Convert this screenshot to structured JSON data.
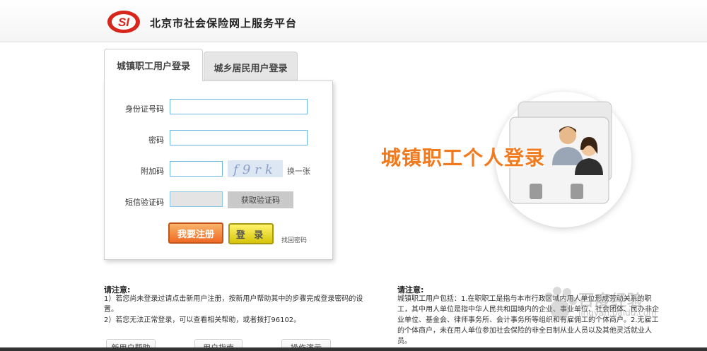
{
  "header": {
    "site_title": "北京市社会保险网上服务平台",
    "logo_text": "SI"
  },
  "tabs": [
    {
      "label": "城镇职工用户登录",
      "active": true
    },
    {
      "label": "城乡居民用户登录",
      "active": false
    }
  ],
  "form": {
    "id_label": "身份证号码",
    "id_value": "",
    "password_label": "密码",
    "password_value": "",
    "captcha_label": "附加码",
    "captcha_value": "",
    "captcha_image_text": "f9rk",
    "refresh_label": "换一张",
    "sms_label": "短信验证码",
    "sms_value": "",
    "sms_button_label": "获取验证码",
    "register_label": "我要注册",
    "login_label": "登 录",
    "forgot_label": "找回密码"
  },
  "promo": {
    "text": "城镇职工个人登录"
  },
  "notice_left": {
    "title": "请注意:",
    "lines": [
      "1）若您尚未登录过请点击新用户注册，按新用户帮助其中的步骤完成登录密码的设",
      "置。",
      "2）若您无法正常登录，可以查看相关帮助，或者拨打96102。"
    ]
  },
  "notice_right": {
    "title": "请注意:",
    "lines": [
      "城镇职工用户包括：1.在职职工是指与本市行政区域内用人单位形成劳动关系的职",
      "工，其中用人单位是指中华人民共和国境内的企业、事业单位、社会团体、民办非企",
      "业单位、基金会、律师事务所、会计事务所等组织和有雇佣工的个体商户。2.无雇工",
      "的个体商户，未在用人单位参加社会保险的非全日制从业人员以及其他灵活就业人",
      "员。"
    ]
  },
  "bottom_buttons": [
    "新用户帮助",
    "用户指南",
    "操作演示"
  ],
  "watermark": {
    "text": "百度经验",
    "sub": "jingyan.baidu.com"
  },
  "colors": {
    "accent_orange": "#f27a1e",
    "input_border": "#6cb8e0",
    "logo_red": "#d7261c"
  }
}
